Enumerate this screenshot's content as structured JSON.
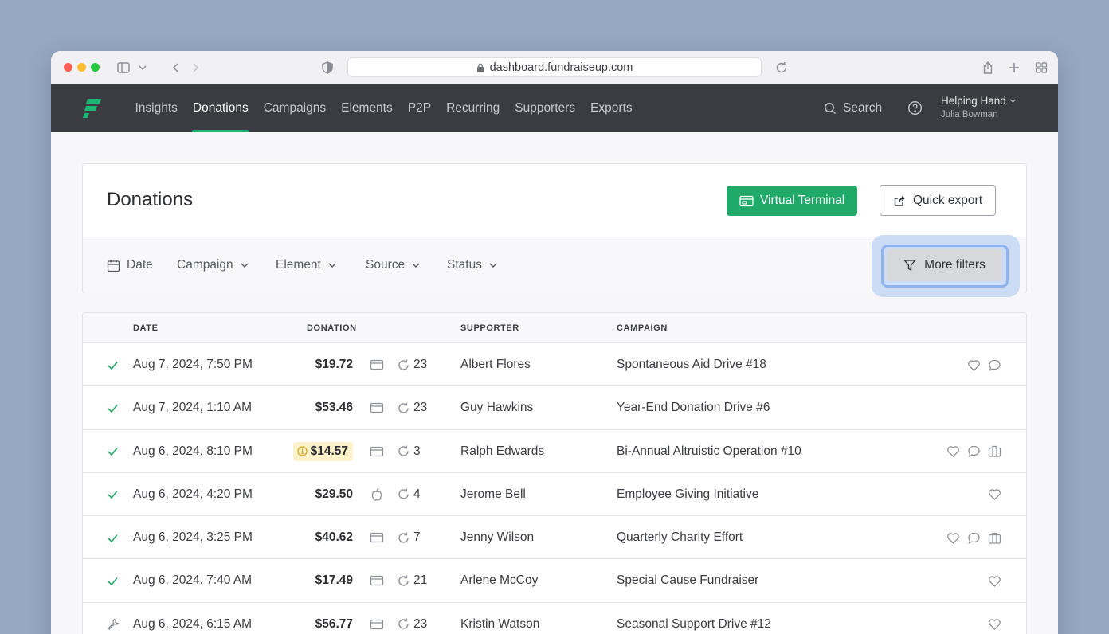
{
  "browser": {
    "url": "dashboard.fundraiseup.com"
  },
  "nav": {
    "items": [
      {
        "label": "Insights",
        "active": false
      },
      {
        "label": "Donations",
        "active": true
      },
      {
        "label": "Campaigns",
        "active": false
      },
      {
        "label": "Elements",
        "active": false
      },
      {
        "label": "P2P",
        "active": false
      },
      {
        "label": "Recurring",
        "active": false
      },
      {
        "label": "Supporters",
        "active": false
      },
      {
        "label": "Exports",
        "active": false
      }
    ],
    "search_label": "Search",
    "org_name": "Helping Hand",
    "user_name": "Julia Bowman",
    "accent": "#1fb573"
  },
  "page": {
    "title": "Donations",
    "virtual_terminal_label": "Virtual Terminal",
    "quick_export_label": "Quick export",
    "primary_color": "#1faa6a"
  },
  "filters": {
    "date": "Date",
    "campaign": "Campaign",
    "element": "Element",
    "source": "Source",
    "status": "Status",
    "more": "More filters"
  },
  "table": {
    "columns": {
      "date": "DATE",
      "donation": "DONATION",
      "supporter": "SUPPORTER",
      "campaign": "CAMPAIGN"
    },
    "rows": [
      {
        "status": "success",
        "date": "Aug 7, 2024, 7:50 PM",
        "amount": "$19.72",
        "warning": false,
        "method": "card-icon",
        "recurring": "23",
        "supporter": "Albert Flores",
        "campaign": "Spontaneous Aid Drive #18",
        "flags": [
          "heart-icon",
          "comment-icon"
        ]
      },
      {
        "status": "success",
        "date": "Aug 7, 2024, 1:10 AM",
        "amount": "$53.46",
        "warning": false,
        "method": "card-icon",
        "recurring": "23",
        "supporter": "Guy Hawkins",
        "campaign": "Year-End Donation Drive #6",
        "flags": []
      },
      {
        "status": "success",
        "date": "Aug 6, 2024, 8:10 PM",
        "amount": "$14.57",
        "warning": true,
        "method": "card-icon",
        "recurring": "3",
        "supporter": "Ralph Edwards",
        "campaign": "Bi-Annual Altruistic Operation #10",
        "flags": [
          "heart-icon",
          "comment-icon",
          "briefcase-icon"
        ]
      },
      {
        "status": "success",
        "date": "Aug 6, 2024, 4:20 PM",
        "amount": "$29.50",
        "warning": false,
        "method": "apple-icon",
        "recurring": "4",
        "supporter": "Jerome Bell",
        "campaign": "Employee Giving Initiative",
        "flags": [
          "heart-icon"
        ]
      },
      {
        "status": "success",
        "date": "Aug 6, 2024, 3:25 PM",
        "amount": "$40.62",
        "warning": false,
        "method": "card-icon",
        "recurring": "7",
        "supporter": "Jenny Wilson",
        "campaign": "Quarterly Charity Effort",
        "flags": [
          "heart-icon",
          "comment-icon",
          "briefcase-icon"
        ]
      },
      {
        "status": "success",
        "date": "Aug 6, 2024, 7:40 AM",
        "amount": "$17.49",
        "warning": false,
        "method": "card-icon",
        "recurring": "21",
        "supporter": "Arlene McCoy",
        "campaign": "Special Cause Fundraiser",
        "flags": [
          "heart-icon"
        ]
      },
      {
        "status": "pending",
        "date": "Aug 6, 2024, 6:15 AM",
        "amount": "$56.77",
        "warning": false,
        "method": "card-icon",
        "recurring": "23",
        "supporter": "Kristin Watson",
        "campaign": "Seasonal Support Drive #12",
        "flags": [
          "heart-icon"
        ]
      }
    ]
  }
}
